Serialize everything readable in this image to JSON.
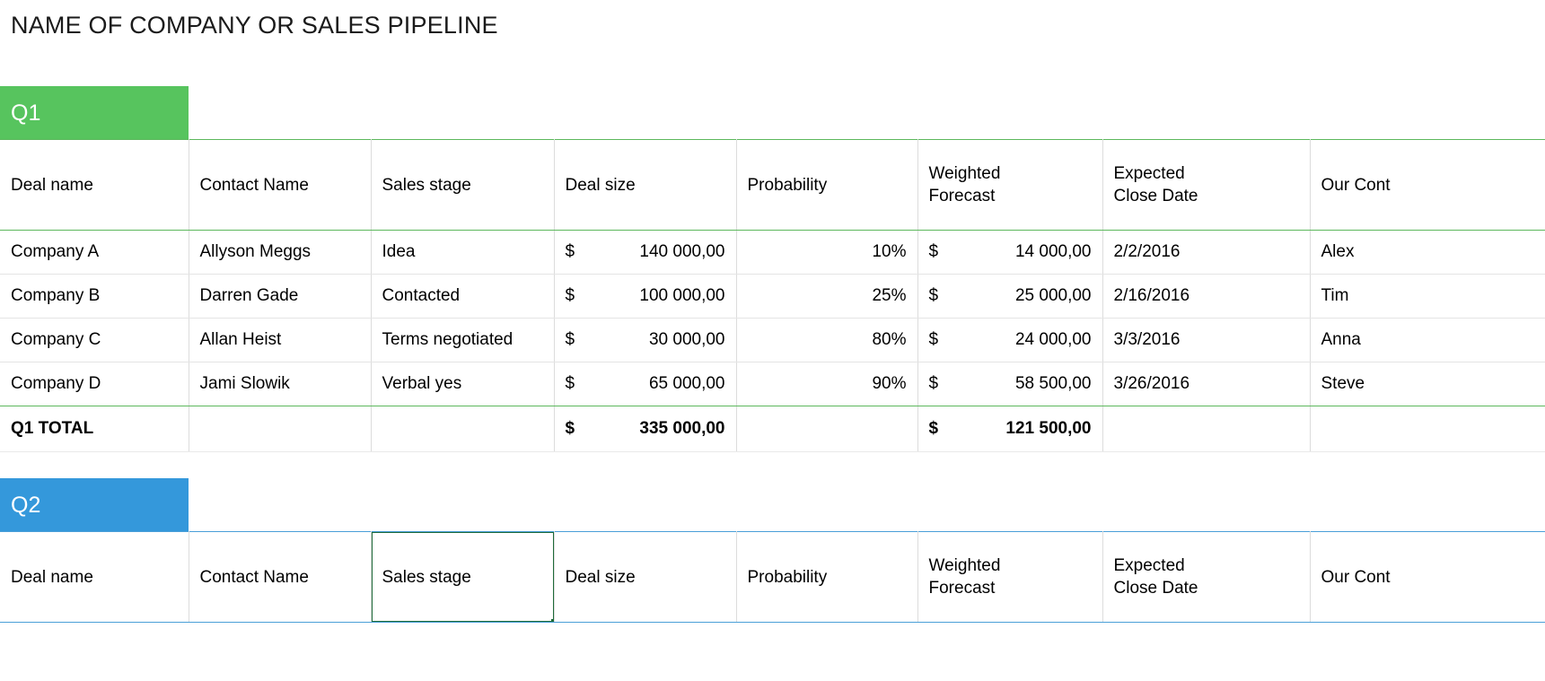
{
  "page": {
    "title": "NAME OF COMPANY OR SALES PIPELINE"
  },
  "colors": {
    "q1_accent": "#57c45e",
    "q2_accent": "#3498db",
    "selection_border": "#1e6b39",
    "grid_line": "#dcdcdc"
  },
  "columns": [
    "Deal name",
    "Contact Name",
    "Sales stage",
    "Deal size",
    "Probability",
    "Weighted Forecast",
    "Expected Close Date",
    "Our Cont"
  ],
  "quarters": [
    {
      "id": "q1",
      "label": "Q1",
      "accent": "#57c45e",
      "headers": {
        "deal_name": "Deal name",
        "contact_name": "Contact Name",
        "sales_stage": "Sales stage",
        "deal_size": "Deal size",
        "probability": "Probability",
        "weighted_forecast_line1": "Weighted",
        "weighted_forecast_line2": "Forecast",
        "expected_close_line1": "Expected",
        "expected_close_line2": "Close Date",
        "our_contact": "Our Cont"
      },
      "rows": [
        {
          "deal_name": "Company A",
          "contact_name": "Allyson Meggs",
          "sales_stage": "Idea",
          "deal_size_symbol": "$",
          "deal_size": "140 000,00",
          "probability": "10%",
          "weighted_symbol": "$",
          "weighted_forecast": "14 000,00",
          "expected_close_date": "2/2/2016",
          "our_contact": "Alex"
        },
        {
          "deal_name": "Company B",
          "contact_name": "Darren Gade",
          "sales_stage": "Contacted",
          "deal_size_symbol": "$",
          "deal_size": "100 000,00",
          "probability": "25%",
          "weighted_symbol": "$",
          "weighted_forecast": "25 000,00",
          "expected_close_date": "2/16/2016",
          "our_contact": "Tim"
        },
        {
          "deal_name": "Company C",
          "contact_name": "Allan Heist",
          "sales_stage": "Terms negotiated",
          "deal_size_symbol": "$",
          "deal_size": "30 000,00",
          "probability": "80%",
          "weighted_symbol": "$",
          "weighted_forecast": "24 000,00",
          "expected_close_date": "3/3/2016",
          "our_contact": "Anna"
        },
        {
          "deal_name": "Company D",
          "contact_name": "Jami Slowik",
          "sales_stage": "Verbal yes",
          "deal_size_symbol": "$",
          "deal_size": "65 000,00",
          "probability": "90%",
          "weighted_symbol": "$",
          "weighted_forecast": "58 500,00",
          "expected_close_date": "3/26/2016",
          "our_contact": "Steve"
        }
      ],
      "total": {
        "label": "Q1 TOTAL",
        "contact_name": "",
        "sales_stage": "",
        "deal_size_symbol": "$",
        "deal_size": "335 000,00",
        "probability": "",
        "weighted_symbol": "$",
        "weighted_forecast": "121 500,00",
        "expected_close_date": "",
        "our_contact": ""
      }
    },
    {
      "id": "q2",
      "label": "Q2",
      "accent": "#3498db",
      "headers": {
        "deal_name": "Deal name",
        "contact_name": "Contact Name",
        "sales_stage": "Sales stage",
        "deal_size": "Deal size",
        "probability": "Probability",
        "weighted_forecast_line1": "Weighted",
        "weighted_forecast_line2": "Forecast",
        "expected_close_line1": "Expected",
        "expected_close_line2": "Close Date",
        "our_contact": "Our Cont"
      },
      "selected_cell": "sales_stage",
      "rows": []
    }
  ]
}
